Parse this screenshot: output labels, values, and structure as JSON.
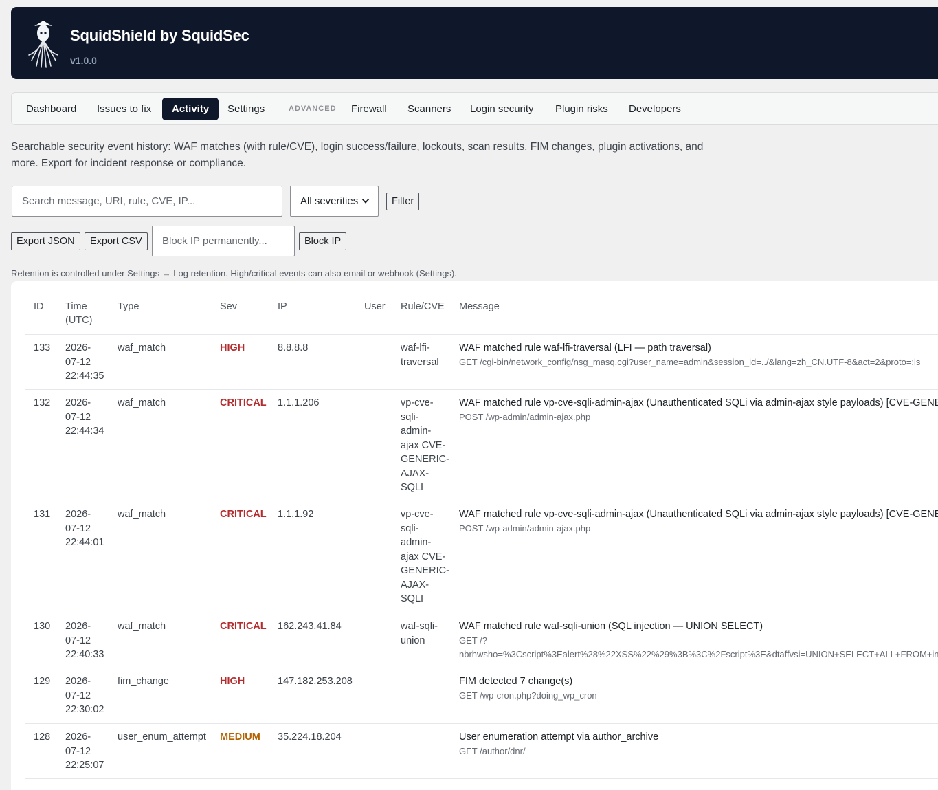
{
  "app": {
    "title": "SquidShield by SquidSec",
    "version": "v1.0.0"
  },
  "nav": {
    "tabs": [
      "Dashboard",
      "Issues to fix",
      "Activity",
      "Settings"
    ],
    "advanced_label": "ADVANCED",
    "advanced_tabs": [
      "Firewall",
      "Scanners",
      "Login security",
      "Plugin risks",
      "Developers"
    ],
    "active": "Activity"
  },
  "intro": "Searchable security event history: WAF matches (with rule/CVE), login success/failure, lockouts, scan results, FIM changes, plugin activations, and more. Export for incident response or compliance.",
  "filters": {
    "search_placeholder": "Search message, URI, rule, CVE, IP...",
    "severity_selected": "All severities",
    "filter_label": "Filter"
  },
  "actions": {
    "export_json": "Export JSON",
    "export_csv": "Export CSV",
    "block_placeholder": "Block IP permanently...",
    "block_label": "Block IP"
  },
  "note": "Retention is controlled under Settings → Log retention. High/critical events can also email or webhook (Settings).",
  "table": {
    "headers": {
      "id": "ID",
      "time_line1": "Time",
      "time_line2": "(UTC)",
      "type": "Type",
      "sev": "Sev",
      "ip": "IP",
      "user": "User",
      "rule": "Rule/CVE",
      "message": "Message"
    },
    "rows": [
      {
        "id": "133",
        "date1": "2026-",
        "date2": "07-12",
        "time": "22:44:35",
        "type": "waf_match",
        "sev": "HIGH",
        "ip": "8.8.8.8",
        "user": "",
        "rule": [
          "waf-lfi-",
          "traversal"
        ],
        "message": "WAF matched rule waf-lfi-traversal (LFI — path traversal)",
        "request": [
          "GET /cgi-bin/network_config/nsg_masq.cgi?user_name=admin&session_id=../&lang=zh_CN.UTF-8&act=2&proto=;ls"
        ]
      },
      {
        "id": "132",
        "date1": "2026-",
        "date2": "07-12",
        "time": "22:44:34",
        "type": "waf_match",
        "sev": "CRITICAL",
        "ip": "1.1.1.206",
        "user": "",
        "rule": [
          "vp-cve-",
          "sqli-",
          "admin-",
          "ajax CVE-",
          "GENERIC-",
          "AJAX-",
          "SQLI"
        ],
        "message": "WAF matched rule vp-cve-sqli-admin-ajax (Unauthenticated SQLi via admin-ajax style payloads) [CVE-GENERIC-AJAX-SQLI]",
        "request": [
          "POST /wp-admin/admin-ajax.php"
        ]
      },
      {
        "id": "131",
        "date1": "2026-",
        "date2": "07-12",
        "time": "22:44:01",
        "type": "waf_match",
        "sev": "CRITICAL",
        "ip": "1.1.1.92",
        "user": "",
        "rule": [
          "vp-cve-",
          "sqli-",
          "admin-",
          "ajax CVE-",
          "GENERIC-",
          "AJAX-",
          "SQLI"
        ],
        "message": "WAF matched rule vp-cve-sqli-admin-ajax (Unauthenticated SQLi via admin-ajax style payloads) [CVE-GENERIC-AJAX-SQLI]",
        "request": [
          "POST /wp-admin/admin-ajax.php"
        ]
      },
      {
        "id": "130",
        "date1": "2026-",
        "date2": "07-12",
        "time": "22:40:33",
        "type": "waf_match",
        "sev": "CRITICAL",
        "ip": "162.243.41.84",
        "user": "",
        "rule": [
          "waf-sqli-",
          "union"
        ],
        "message": "WAF matched rule waf-sqli-union (SQL injection — UNION SELECT)",
        "request": [
          "GET /?",
          "nbrhwsho=%3Cscript%3Ealert%28%22XSS%22%29%3B%3C%2Fscript%3E&dtaffvsi=UNION+SELECT+ALL+FROM+information_schema"
        ]
      },
      {
        "id": "129",
        "date1": "2026-",
        "date2": "07-12",
        "time": "22:30:02",
        "type": "fim_change",
        "sev": "HIGH",
        "ip": "147.182.253.208",
        "user": "",
        "rule": [],
        "message": "FIM detected 7 change(s)",
        "request": [
          "GET /wp-cron.php?doing_wp_cron"
        ]
      },
      {
        "id": "128",
        "date1": "2026-",
        "date2": "07-12",
        "time": "22:25:07",
        "type": "user_enum_attempt",
        "sev": "MEDIUM",
        "ip": "35.224.18.204",
        "user": "",
        "rule": [],
        "message": "User enumeration attempt via author_archive",
        "request": [
          "GET /author/dnr/"
        ]
      }
    ]
  },
  "colors": {
    "header_bg": "#0f172a",
    "sev_high": "#b32d2e",
    "sev_critical": "#b32d2e",
    "sev_medium": "#b26200"
  }
}
